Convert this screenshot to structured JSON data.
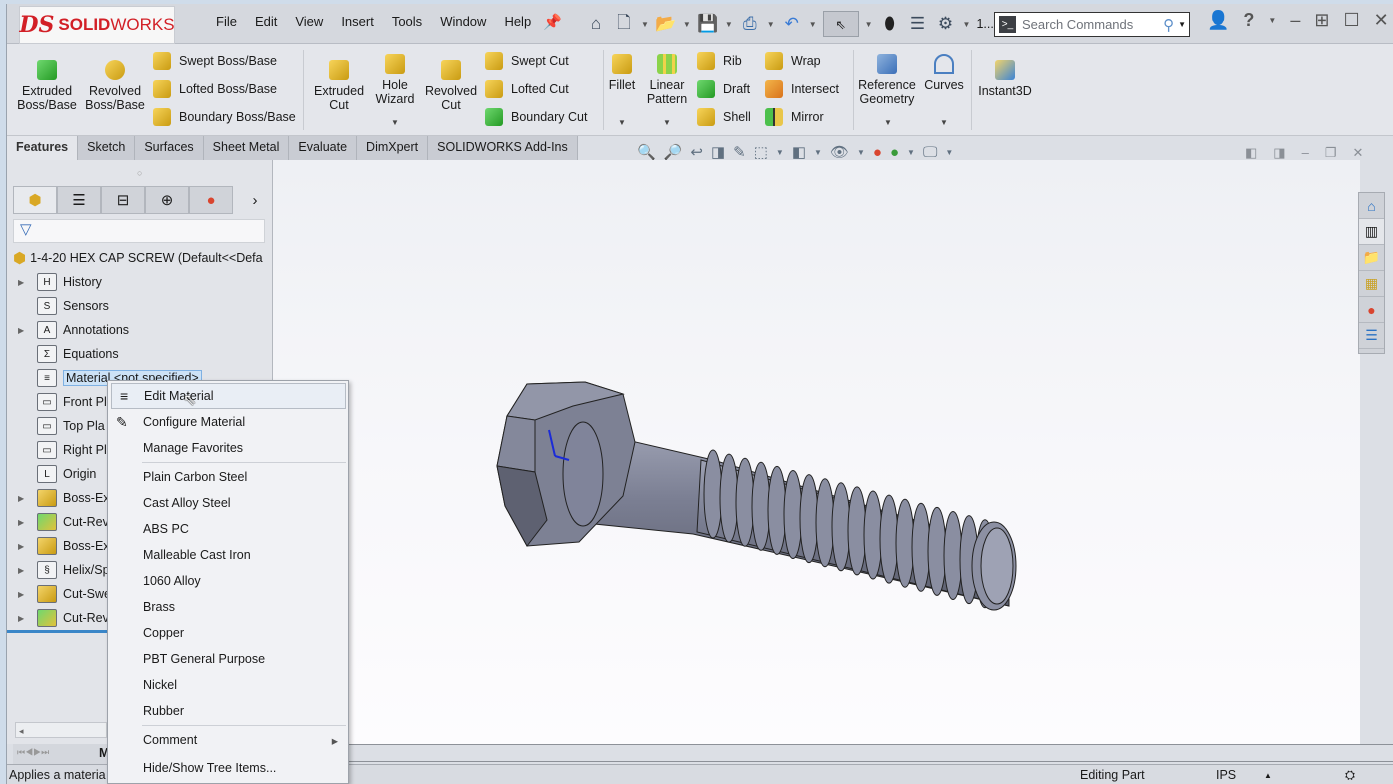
{
  "app": {
    "logo_ds": "DS",
    "logo_text_bold": "SOLID",
    "logo_text_light": "WORKS"
  },
  "menu": [
    "File",
    "Edit",
    "View",
    "Insert",
    "Tools",
    "Window",
    "Help"
  ],
  "quick_access": {
    "overflow_label": "1..."
  },
  "search": {
    "placeholder": "Search Commands"
  },
  "ribbon": {
    "extruded_boss": "Extruded Boss/Base",
    "revolved_boss": "Revolved Boss/Base",
    "swept_boss": "Swept Boss/Base",
    "lofted_boss": "Lofted Boss/Base",
    "boundary_boss": "Boundary Boss/Base",
    "extruded_cut": "Extruded Cut",
    "hole_wizard": "Hole Wizard",
    "revolved_cut": "Revolved Cut",
    "swept_cut": "Swept Cut",
    "lofted_cut": "Lofted Cut",
    "boundary_cut": "Boundary Cut",
    "fillet": "Fillet",
    "linear_pattern": "Linear Pattern",
    "rib": "Rib",
    "draft": "Draft",
    "shell": "Shell",
    "wrap": "Wrap",
    "intersect": "Intersect",
    "mirror": "Mirror",
    "reference_geometry": "Reference Geometry",
    "curves": "Curves",
    "instant3d": "Instant3D"
  },
  "tabs": [
    "Features",
    "Sketch",
    "Surfaces",
    "Sheet Metal",
    "Evaluate",
    "DimXpert",
    "SOLIDWORKS Add-Ins"
  ],
  "tree": {
    "root": "1-4-20 HEX CAP SCREW  (Default<<Defa",
    "items": [
      {
        "label": "History",
        "expand": true,
        "icon": "H"
      },
      {
        "label": "Sensors",
        "expand": false,
        "icon": "S"
      },
      {
        "label": "Annotations",
        "expand": true,
        "icon": "A"
      },
      {
        "label": "Equations",
        "expand": false,
        "icon": "Σ"
      },
      {
        "label": "Material <not specified>",
        "expand": false,
        "icon": "≡",
        "selected": true
      },
      {
        "label": "Front Pl",
        "expand": false,
        "icon": "▭"
      },
      {
        "label": "Top Pla",
        "expand": false,
        "icon": "▭"
      },
      {
        "label": "Right Pl",
        "expand": false,
        "icon": "▭"
      },
      {
        "label": "Origin",
        "expand": false,
        "icon": "L"
      },
      {
        "label": "Boss-Ex",
        "expand": true,
        "icon": "■"
      },
      {
        "label": "Cut-Rev",
        "expand": true,
        "icon": "■"
      },
      {
        "label": "Boss-Ex",
        "expand": true,
        "icon": "■"
      },
      {
        "label": "Helix/Sp",
        "expand": true,
        "icon": "§"
      },
      {
        "label": "Cut-Swe",
        "expand": true,
        "icon": "■"
      },
      {
        "label": "Cut-Rev",
        "expand": true,
        "icon": "■"
      }
    ]
  },
  "context_menu": {
    "top": [
      "Edit Material",
      "Configure Material",
      "Manage Favorites"
    ],
    "materials": [
      "Plain Carbon Steel",
      "Cast Alloy Steel",
      "ABS PC",
      "Malleable Cast Iron",
      "1060 Alloy",
      "Brass",
      "Copper",
      "PBT General Purpose",
      "Nickel",
      "Rubber"
    ],
    "bottom": [
      "Comment",
      "Hide/Show Tree Items..."
    ]
  },
  "bottom_tab": "M",
  "status": {
    "left": "Applies a materia",
    "mode": "Editing Part",
    "units": "IPS"
  }
}
